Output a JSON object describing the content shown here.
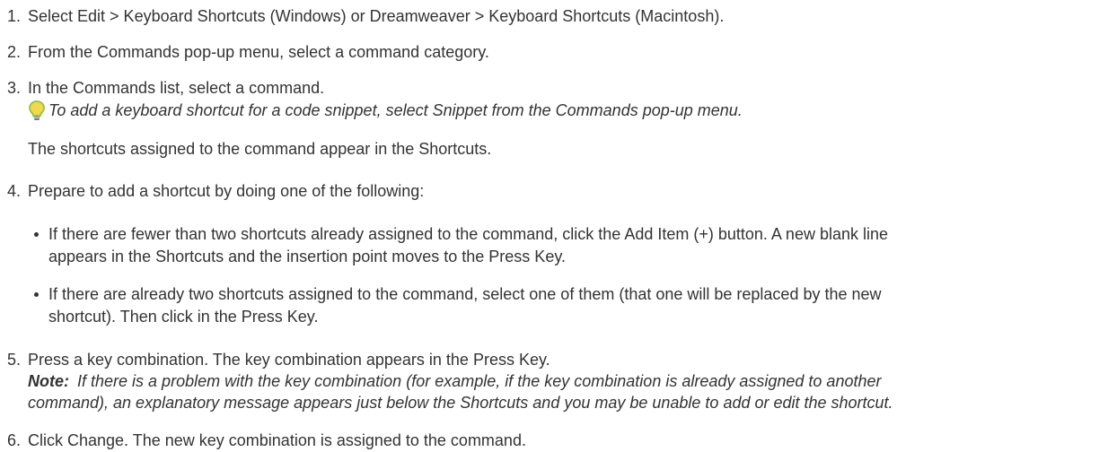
{
  "steps": [
    {
      "number": "1.",
      "text": "Select Edit > Keyboard Shortcuts (Windows) or Dreamweaver > Keyboard Shortcuts (Macintosh)."
    },
    {
      "number": "2.",
      "text": "From the Commands pop-up menu, select a command category."
    },
    {
      "number": "3.",
      "text": "In the Commands list, select a command.",
      "tip": "To add a keyboard shortcut for a code snippet, select Snippet from the Commands pop-up menu.",
      "tip_icon": "lightbulb-icon",
      "followup": "The shortcuts assigned to the command appear in the Shortcuts."
    },
    {
      "number": "4.",
      "text": "Prepare to add a shortcut by doing one of the following:",
      "bullets": [
        {
          "line1": "If there are fewer than two shortcuts already assigned to the command, click the Add Item (+) button. A new blank line",
          "line2": "appears in the Shortcuts and the insertion point moves to the Press Key."
        },
        {
          "line1": "If there are already two shortcuts assigned to the command, select one of them (that one will be replaced by the new",
          "line2": "shortcut). Then click in the Press Key."
        }
      ]
    },
    {
      "number": "5.",
      "text": "Press a key combination. The key combination appears in the Press Key.",
      "note_label": "Note:",
      "note_line1": "If there is a problem with the key combination (for example, if the key combination is already assigned to another",
      "note_line2": "command), an explanatory message appears just below the Shortcuts and you may be unable to add or edit the shortcut."
    },
    {
      "number": "6.",
      "text": "Click Change. The new key combination is assigned to the command."
    }
  ],
  "colors": {
    "text": "#333333",
    "tip_icon_outline": "#8dc63f"
  }
}
